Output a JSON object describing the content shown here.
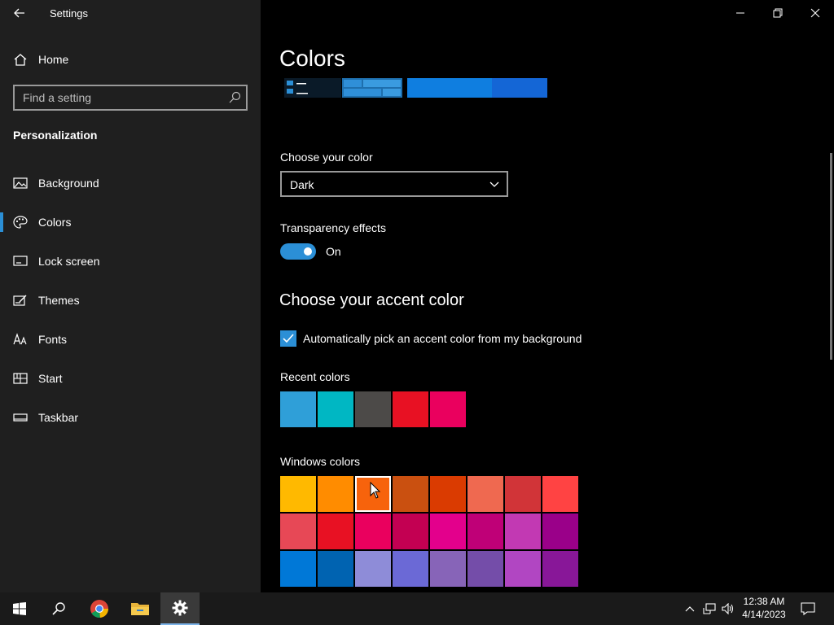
{
  "app": {
    "title": "Settings"
  },
  "sidebar": {
    "home": "Home",
    "search_placeholder": "Find a setting",
    "section": "Personalization",
    "items": [
      {
        "label": "Background",
        "icon": "picture-icon"
      },
      {
        "label": "Colors",
        "icon": "palette-icon",
        "active": true
      },
      {
        "label": "Lock screen",
        "icon": "lock-screen-icon"
      },
      {
        "label": "Themes",
        "icon": "themes-icon"
      },
      {
        "label": "Fonts",
        "icon": "fonts-icon"
      },
      {
        "label": "Start",
        "icon": "start-icon"
      },
      {
        "label": "Taskbar",
        "icon": "taskbar-icon"
      }
    ]
  },
  "main": {
    "title": "Colors",
    "choose_color_label": "Choose your color",
    "choose_color_value": "Dark",
    "transparency_label": "Transparency effects",
    "transparency_state": "On",
    "accent_heading": "Choose your accent color",
    "auto_accent_label": "Automatically pick an accent color from my background",
    "recent_label": "Recent colors",
    "recent_colors": [
      "#2f9fd8",
      "#00b7c3",
      "#4c4a48",
      "#e81123",
      "#ea005e"
    ],
    "windows_label": "Windows colors",
    "windows_colors": [
      [
        "#ffb900",
        "#ff8c00",
        "#f7630c",
        "#ca5010",
        "#da3b01",
        "#ef6950",
        "#d13438",
        "#ff4343"
      ],
      [
        "#e74856",
        "#e81123",
        "#ea005e",
        "#c30052",
        "#e3008c",
        "#bf0077",
        "#c239b3",
        "#9a0089"
      ],
      [
        "#0078d7",
        "#0063b1",
        "#8e8cd8",
        "#6b69d6",
        "#8764b8",
        "#744da9",
        "#b146c2",
        "#881798"
      ]
    ],
    "selected_color": "#f7630c"
  },
  "taskbar": {
    "time": "12:38 AM",
    "date": "4/14/2023",
    "accent": "#2b8fd6"
  }
}
